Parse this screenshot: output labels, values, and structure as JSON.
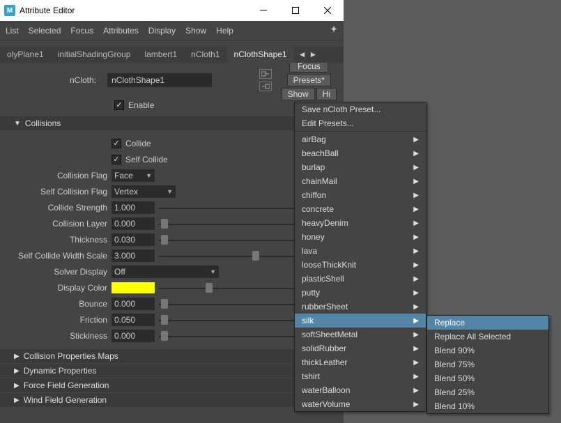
{
  "window": {
    "title": "Attribute Editor"
  },
  "menubar": [
    "List",
    "Selected",
    "Focus",
    "Attributes",
    "Display",
    "Show",
    "Help"
  ],
  "tabs": [
    "olyPlane1",
    "initialShadingGroup",
    "lambert1",
    "nCloth1",
    "nClothShape1"
  ],
  "active_tab": 4,
  "node": {
    "label": "nCloth:",
    "value": "nClothShape1"
  },
  "right_buttons": {
    "focus": "Focus",
    "presets": "Presets*",
    "show": "Show",
    "hide": "Hi"
  },
  "enable": {
    "label": "Enable",
    "checked": true
  },
  "collisions": {
    "header": "Collisions",
    "collide": {
      "label": "Collide",
      "checked": true
    },
    "selfCollide": {
      "label": "Self Collide",
      "checked": true
    },
    "collisionFlag": {
      "label": "Collision Flag",
      "value": "Face"
    },
    "selfCollisionFlag": {
      "label": "Self Collision Flag",
      "value": "Vertex"
    },
    "collideStrength": {
      "label": "Collide Strength",
      "value": "1.000",
      "pos": 100
    },
    "collisionLayer": {
      "label": "Collision Layer",
      "value": "0.000",
      "pos": 1
    },
    "thickness": {
      "label": "Thickness",
      "value": "0.030",
      "pos": 1
    },
    "selfCollideWidthScale": {
      "label": "Self Collide Width Scale",
      "value": "3.000",
      "pos": 54
    },
    "solverDisplay": {
      "label": "Solver Display",
      "value": "Off"
    },
    "displayColor": {
      "label": "Display Color",
      "hex": "#ffff00",
      "pos": 28
    },
    "bounce": {
      "label": "Bounce",
      "value": "0.000",
      "pos": 1
    },
    "friction": {
      "label": "Friction",
      "value": "0.050",
      "pos": 1
    },
    "stickiness": {
      "label": "Stickiness",
      "value": "0.000",
      "pos": 1
    }
  },
  "sections": [
    "Collision Properties Maps",
    "Dynamic Properties",
    "Force Field Generation",
    "Wind Field Generation"
  ],
  "presets_menu": {
    "top": [
      "Save nCloth Preset...",
      "Edit Presets..."
    ],
    "items": [
      "airBag",
      "beachBall",
      "burlap",
      "chainMail",
      "chiffon",
      "concrete",
      "heavyDenim",
      "honey",
      "lava",
      "looseThickKnit",
      "plasticShell",
      "putty",
      "rubberSheet",
      "silk",
      "softSheetMetal",
      "solidRubber",
      "thickLeather",
      "tshirt",
      "waterBalloon",
      "waterVolume"
    ],
    "hover_index": 13
  },
  "submenu": {
    "items": [
      "Replace",
      "Replace All Selected",
      "Blend 90%",
      "Blend 75%",
      "Blend 50%",
      "Blend 25%",
      "Blend 10%"
    ],
    "hover_index": 0
  }
}
